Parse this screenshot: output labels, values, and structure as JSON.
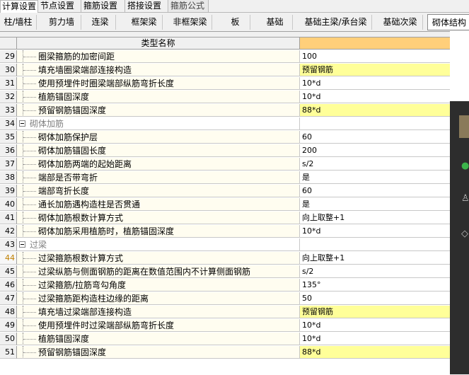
{
  "top_tabs": [
    "计算设置",
    "节点设置",
    "箍筋设置",
    "搭接设置",
    "箍筋公式"
  ],
  "component_tabs": [
    "柱/墙柱",
    "剪力墙",
    "连梁",
    "框架梁",
    "非框架梁",
    "板",
    "基础",
    "基础主梁/承台梁",
    "基础次梁",
    "砌体结构"
  ],
  "grid": {
    "header_name": "类型名称",
    "rows": [
      {
        "num": "29",
        "name": "圈梁箍筋的加密间距",
        "value": "100"
      },
      {
        "num": "30",
        "name": "填充墙圈梁端部连接构造",
        "value": "预留钢筋"
      },
      {
        "num": "31",
        "name": "使用预埋件时圈梁端部纵筋弯折长度",
        "value": "10*d"
      },
      {
        "num": "32",
        "name": "植筋锚固深度",
        "value": "10*d"
      },
      {
        "num": "33",
        "name": "预留钢筋锚固深度",
        "value": "88*d"
      },
      {
        "num": "34",
        "name": "砌体加筋",
        "value": ""
      },
      {
        "num": "35",
        "name": "砌体加筋保护层",
        "value": "60"
      },
      {
        "num": "36",
        "name": "砌体加筋锚固长度",
        "value": "200"
      },
      {
        "num": "37",
        "name": "砌体加筋两端的起始距离",
        "value": "s/2"
      },
      {
        "num": "38",
        "name": "端部是否带弯折",
        "value": "是"
      },
      {
        "num": "39",
        "name": "端部弯折长度",
        "value": "60"
      },
      {
        "num": "40",
        "name": "通长加筋遇构造柱是否贯通",
        "value": "是"
      },
      {
        "num": "41",
        "name": "砌体加筋根数计算方式",
        "value": "向上取整+1"
      },
      {
        "num": "42",
        "name": "砌体加筋采用植筋时，植筋锚固深度",
        "value": "10*d"
      },
      {
        "num": "43",
        "name": "过梁",
        "value": ""
      },
      {
        "num": "44",
        "name": "过梁箍筋根数计算方式",
        "value": "向上取整+1"
      },
      {
        "num": "45",
        "name": "过梁纵筋与侧面钢筋的距离在数值范围内不计算侧面钢筋",
        "value": "s/2"
      },
      {
        "num": "46",
        "name": "过梁箍筋/拉筋弯勾角度",
        "value": "135°"
      },
      {
        "num": "47",
        "name": "过梁箍筋距构造柱边缘的距离",
        "value": "50"
      },
      {
        "num": "48",
        "name": "填充墙过梁端部连接构造",
        "value": "预留钢筋"
      },
      {
        "num": "49",
        "name": "使用预埋件时过梁端部纵筋弯折长度",
        "value": "10*d"
      },
      {
        "num": "50",
        "name": "植筋锚固深度",
        "value": "10*d"
      },
      {
        "num": "51",
        "name": "预留钢筋锚固深度",
        "value": "88*d"
      }
    ]
  },
  "colors": {
    "header_value_bg": "#ffcf7a",
    "highlight_value_bg": "#ffff99",
    "name_bg": "#fffdf0"
  }
}
